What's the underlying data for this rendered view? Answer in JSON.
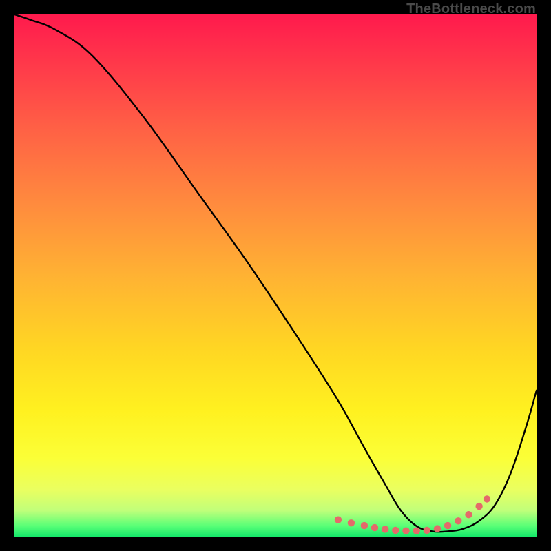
{
  "watermark": "TheBottleneck.com",
  "colors": {
    "frame": "#000000",
    "curve": "#000000",
    "dots": "#e46a6a",
    "grad_top": "#ff1a4d",
    "grad_bottom": "#15e86a"
  },
  "chart_data": {
    "type": "line",
    "title": "",
    "xlabel": "",
    "ylabel": "",
    "xlim": [
      0,
      100
    ],
    "ylim": [
      0,
      100
    ],
    "grid": false,
    "annotations": [
      "TheBottleneck.com"
    ],
    "series": [
      {
        "name": "curve",
        "x": [
          0,
          3,
          8,
          15,
          25,
          35,
          45,
          55,
          62,
          67,
          71,
          74,
          77,
          80,
          83,
          86,
          89,
          92,
          95,
          98,
          100
        ],
        "y": [
          100,
          99,
          97,
          92,
          80,
          66,
          52,
          37,
          26,
          17,
          10,
          5,
          2,
          1,
          1,
          1.5,
          3,
          6,
          12,
          21,
          28
        ]
      }
    ],
    "highlight_points": {
      "name": "dotted-segment",
      "x": [
        62,
        64.5,
        67,
        69,
        71,
        73,
        75,
        77,
        79,
        81,
        83,
        85,
        87,
        89,
        90.5
      ],
      "y": [
        3.2,
        2.6,
        2.1,
        1.7,
        1.4,
        1.2,
        1.1,
        1.1,
        1.2,
        1.5,
        2.1,
        3.0,
        4.2,
        5.8,
        7.2
      ]
    }
  }
}
